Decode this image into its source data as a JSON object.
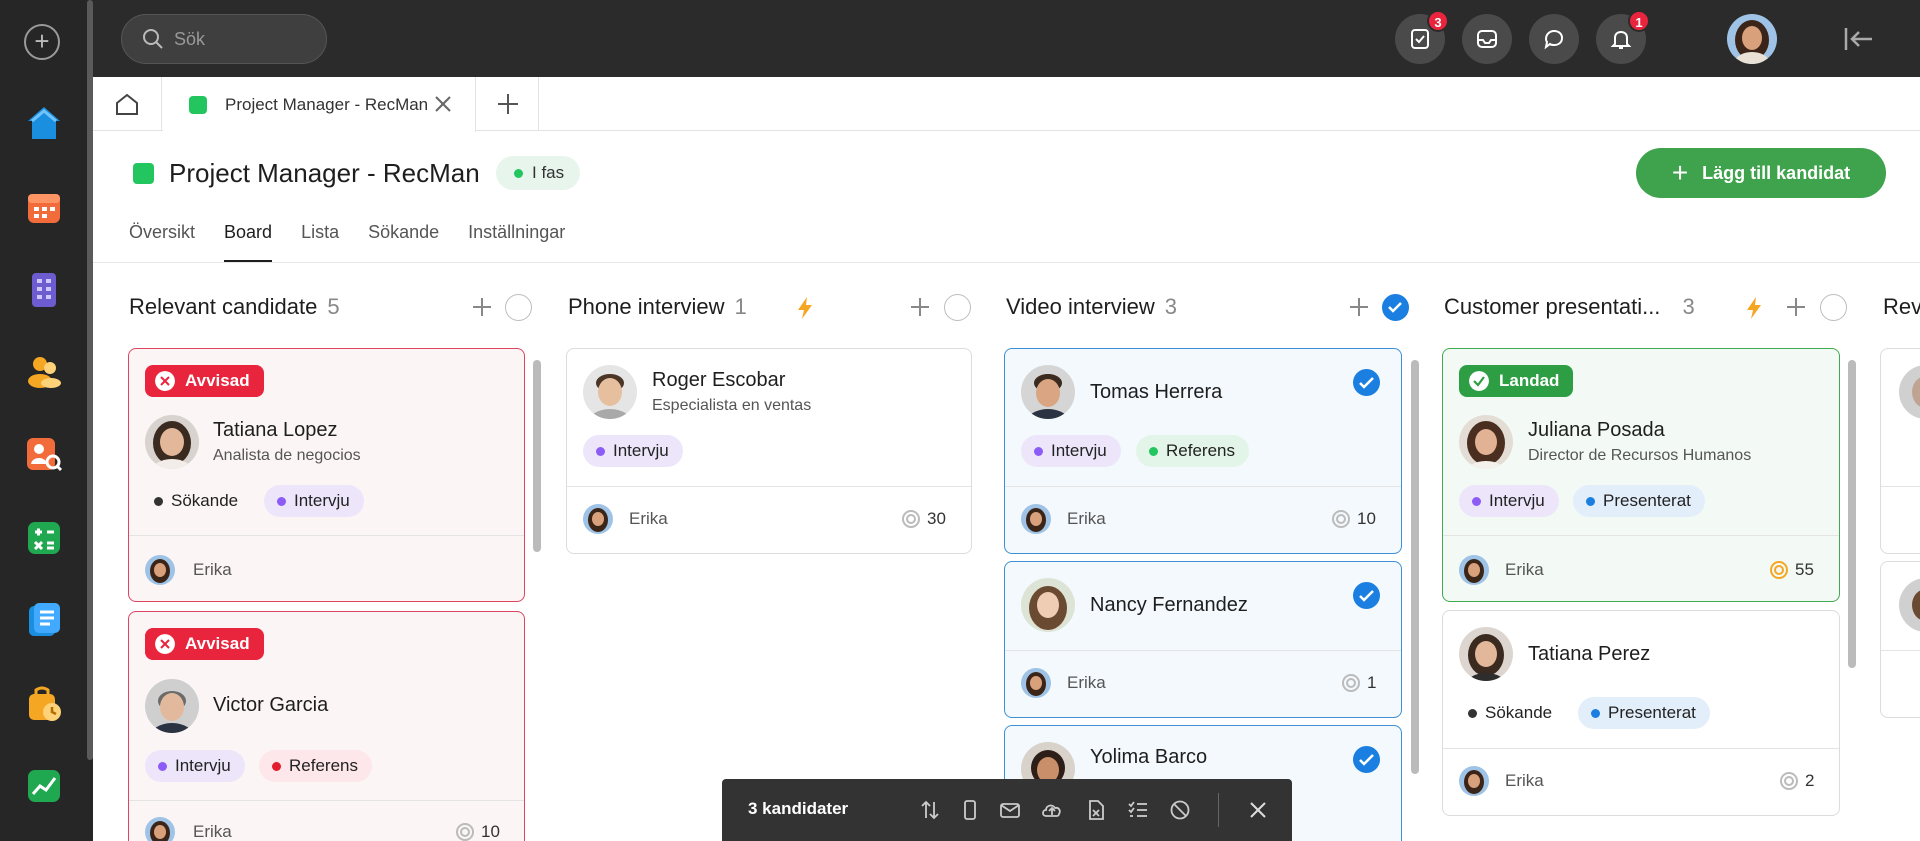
{
  "topbar": {
    "search_placeholder": "Sök",
    "tasks_badge": "3",
    "notifications_badge": "1"
  },
  "tabs": {
    "active_label": "Project Manager - RecMan"
  },
  "header": {
    "title": "Project Manager - RecMan",
    "phase": "I fas",
    "add_button": "Lägg till kandidat"
  },
  "subnav": [
    "Översikt",
    "Board",
    "Lista",
    "Sökande",
    "Inställningar"
  ],
  "columns": [
    {
      "title": "Relevant candidate",
      "count": "5",
      "bolt": false,
      "checked": false,
      "cards": [
        {
          "status": "Avvisad",
          "name": "Tatiana Lopez",
          "role": "Analista de negocios",
          "tags": [
            "Sökande",
            "Intervju"
          ],
          "owner": "Erika",
          "score": ""
        },
        {
          "status": "Avvisad",
          "name": "Victor Garcia",
          "role": "",
          "tags": [
            "Intervju",
            "Referens"
          ],
          "owner": "Erika",
          "score": "10"
        }
      ]
    },
    {
      "title": "Phone interview",
      "count": "1",
      "bolt": true,
      "checked": false,
      "cards": [
        {
          "status": "",
          "name": "Roger Escobar",
          "role": "Especialista en ventas",
          "tags": [
            "Intervju"
          ],
          "owner": "Erika",
          "score": "30"
        }
      ]
    },
    {
      "title": "Video interview",
      "count": "3",
      "bolt": false,
      "checked": true,
      "cards": [
        {
          "status": "",
          "name": "Tomas Herrera",
          "role": "",
          "tags": [
            "Intervju",
            "Referens"
          ],
          "owner": "Erika",
          "score": "10"
        },
        {
          "status": "",
          "name": "Nancy Fernandez",
          "role": "",
          "tags": [],
          "owner": "Erika",
          "score": "1"
        },
        {
          "status": "",
          "name": "Yolima Barco",
          "role": "",
          "tags": [],
          "owner": "",
          "score": ""
        }
      ]
    },
    {
      "title": "Customer presentati...",
      "count": "3",
      "bolt": true,
      "checked": false,
      "cards": [
        {
          "status": "Landad",
          "name": "Juliana Posada",
          "role": "Director de Recursos Humanos",
          "tags": [
            "Intervju",
            "Presenterat"
          ],
          "owner": "Erika",
          "score": "55"
        },
        {
          "status": "",
          "name": "Tatiana Perez",
          "role": "",
          "tags": [
            "Sökande",
            "Presenterat"
          ],
          "owner": "Erika",
          "score": "2"
        }
      ]
    },
    {
      "title": "Rev",
      "count": "",
      "bolt": false,
      "checked": false,
      "cards": []
    }
  ],
  "bulk_bar": {
    "label": "3 kandidater"
  },
  "colors": {
    "accent_green": "#3fa34d",
    "reject_red": "#e8253d",
    "select_blue": "#1a7fe0",
    "rail_bg": "#262626"
  }
}
